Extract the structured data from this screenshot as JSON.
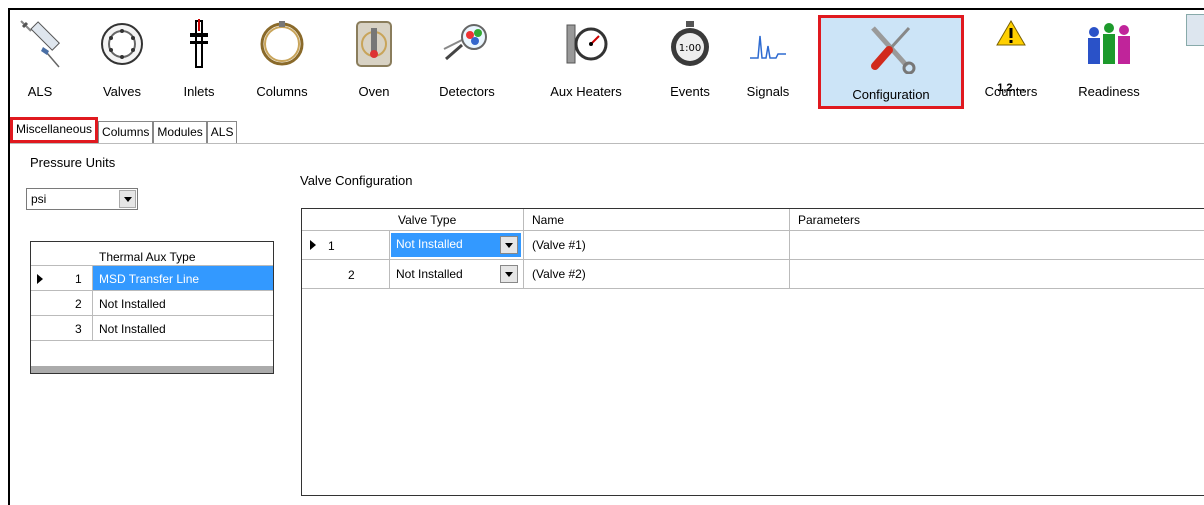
{
  "toolbar": {
    "items": [
      {
        "label": "ALS",
        "icon": "syringe-icon"
      },
      {
        "label": "Valves",
        "icon": "valve-icon"
      },
      {
        "label": "Inlets",
        "icon": "inlet-icon"
      },
      {
        "label": "Columns",
        "icon": "column-coil-icon"
      },
      {
        "label": "Oven",
        "icon": "oven-icon"
      },
      {
        "label": "Detectors",
        "icon": "detector-magnifier-icon"
      },
      {
        "label": "Aux Heaters",
        "icon": "gauge-icon"
      },
      {
        "label": "Events",
        "icon": "stopwatch-icon"
      },
      {
        "label": "Signals",
        "icon": "chromatogram-icon"
      },
      {
        "label": "Configuration",
        "icon": "screwdriver-wrench-icon"
      },
      {
        "label": "Counters",
        "icon": "warning-icon"
      },
      {
        "label": "Readiness",
        "icon": "people-icon"
      }
    ],
    "counters_sub": "1,2,...",
    "stopwatch_text": "1:00",
    "selected": "Configuration",
    "highlight_color": "#e0191f"
  },
  "tabs": [
    {
      "label": "Miscellaneous",
      "active": true
    },
    {
      "label": "Columns",
      "active": false
    },
    {
      "label": "Modules",
      "active": false
    },
    {
      "label": "ALS",
      "active": false
    }
  ],
  "pressure": {
    "label": "Pressure Units",
    "value": "psi"
  },
  "thermal_aux": {
    "header": "Thermal Aux Type",
    "rows": [
      {
        "num": "1",
        "type": "MSD Transfer Line",
        "selected": true
      },
      {
        "num": "2",
        "type": "Not Installed",
        "selected": false
      },
      {
        "num": "3",
        "type": "Not Installed",
        "selected": false
      }
    ]
  },
  "valve_config": {
    "label": "Valve Configuration",
    "headers": {
      "type": "Valve Type",
      "name": "Name",
      "params": "Parameters"
    },
    "rows": [
      {
        "num": "1",
        "type": "Not Installed",
        "name": "(Valve #1)",
        "params": "",
        "selected": true
      },
      {
        "num": "2",
        "type": "Not Installed",
        "name": "(Valve #2)",
        "params": "",
        "selected": false
      }
    ]
  }
}
